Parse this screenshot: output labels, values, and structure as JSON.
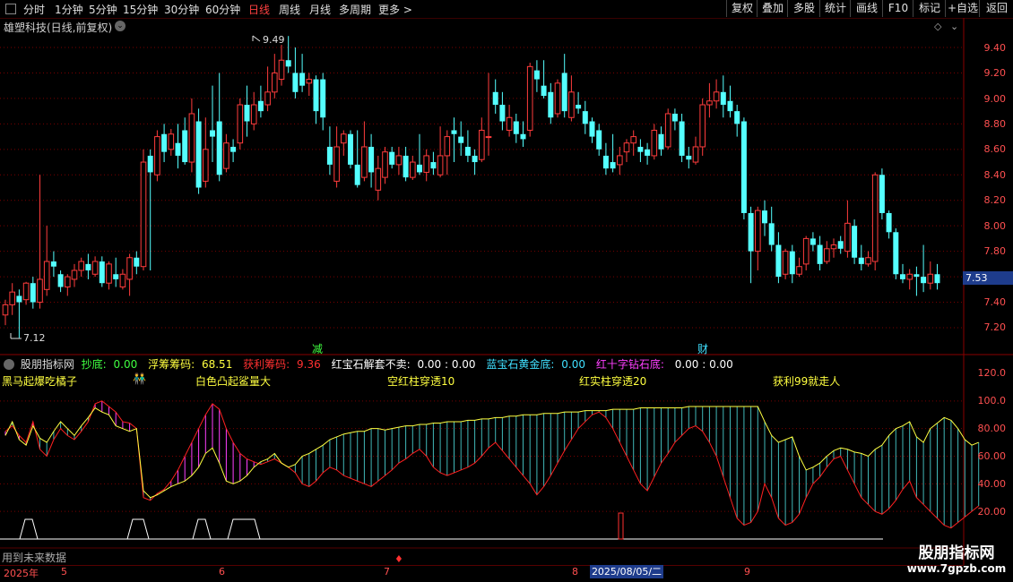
{
  "toolbar": {
    "periods": [
      "分时",
      "1分钟",
      "5分钟",
      "15分钟",
      "30分钟",
      "60分钟",
      "日线",
      "周线",
      "月线",
      "多周期",
      "更多 >"
    ],
    "buttons": [
      "复权",
      "叠加",
      "多股",
      "统计",
      "画线",
      "F10",
      "+自选",
      "返回"
    ]
  },
  "chart_title": "雄塑科技(日线,前复权)",
  "price_axis": [
    "9.40",
    "9.20",
    "9.00",
    "8.80",
    "8.60",
    "8.40",
    "8.20",
    "8.00",
    "7.80",
    "7.53",
    "7.40",
    "7.20"
  ],
  "current_price": "7.53",
  "high_label": "9.49",
  "low_label": "7.12",
  "markers": {
    "jian": "减",
    "cai": "财"
  },
  "indicator": {
    "name": "股朋指标网",
    "items": [
      {
        "label": "抄底:",
        "value": "0.00",
        "color": "#40ff40"
      },
      {
        "label": "浮筹筹码:",
        "value": "68.51",
        "color": "#ffff40"
      },
      {
        "label": "获利筹码:",
        "value": "9.36",
        "color": "#ff3030"
      },
      {
        "label": "红宝石解套不卖:",
        "value": "0.00 : 0.00",
        "color": "#ffffff"
      },
      {
        "label": "蓝宝石黄金底:",
        "value": "0.00",
        "color": "#40e0ff"
      },
      {
        "label": "红十字钻石底:",
        "value": "0.00 : 0.00",
        "color": "#ff40ff"
      }
    ],
    "labels": [
      "黑马起爆吃橘子",
      "白色凸起鲨量大",
      "空红柱穿透10",
      "红实柱穿透20",
      "获利99就走人"
    ],
    "axis": [
      "120.0",
      "100.0",
      "80.00",
      "60.00",
      "40.00",
      "20.00"
    ]
  },
  "bottom_note": "用到未来数据",
  "dates": {
    "year": "2025年",
    "m5": "5",
    "m6": "6",
    "m7": "7",
    "m8": "8",
    "m9": "9",
    "selected": "2025/08/05/二"
  },
  "watermark": {
    "line1": "股朋指标网",
    "line2": "www.7gpzb.com"
  },
  "colors": {
    "up": "#ff3c3c",
    "down": "#54ffff",
    "yellow": "#ffff40",
    "magenta": "#ff40ff",
    "grid": "#7a0000"
  },
  "chart_data": {
    "type": "candlestick",
    "candles": [
      [
        7.3,
        7.38,
        7.42,
        7.22
      ],
      [
        7.38,
        7.48,
        7.55,
        7.3
      ],
      [
        7.45,
        7.4,
        7.5,
        7.12
      ],
      [
        7.42,
        7.55,
        7.56,
        7.38
      ],
      [
        7.55,
        7.4,
        7.6,
        7.35
      ],
      [
        7.4,
        7.58,
        8.4,
        7.35
      ],
      [
        7.5,
        7.72,
        8.0,
        7.45
      ],
      [
        7.72,
        7.68,
        7.8,
        7.6
      ],
      [
        7.62,
        7.52,
        7.65,
        7.48
      ],
      [
        7.52,
        7.6,
        7.62,
        7.45
      ],
      [
        7.58,
        7.65,
        7.7,
        7.52
      ],
      [
        7.65,
        7.72,
        7.75,
        7.6
      ],
      [
        7.7,
        7.65,
        7.78,
        7.58
      ],
      [
        7.62,
        7.72,
        7.76,
        7.6
      ],
      [
        7.72,
        7.55,
        7.76,
        7.52
      ],
      [
        7.55,
        7.7,
        7.72,
        7.5
      ],
      [
        7.62,
        7.58,
        7.75,
        7.52
      ],
      [
        7.52,
        7.62,
        7.66,
        7.5
      ],
      [
        7.58,
        7.75,
        7.78,
        7.45
      ],
      [
        7.75,
        7.68,
        7.8,
        7.62
      ],
      [
        7.68,
        8.5,
        8.6,
        7.65
      ],
      [
        8.55,
        8.42,
        8.6,
        7.65
      ],
      [
        8.4,
        8.7,
        8.75,
        8.35
      ],
      [
        8.72,
        8.58,
        8.8,
        8.5
      ],
      [
        8.6,
        8.72,
        8.76,
        8.55
      ],
      [
        8.65,
        8.55,
        8.8,
        8.45
      ],
      [
        8.75,
        8.5,
        8.85,
        8.48
      ],
      [
        8.5,
        8.88,
        9.0,
        8.42
      ],
      [
        8.82,
        8.3,
        8.92,
        8.25
      ],
      [
        8.35,
        8.6,
        8.85,
        8.3
      ],
      [
        8.75,
        8.7,
        9.1,
        8.5
      ],
      [
        8.82,
        8.4,
        9.2,
        8.35
      ],
      [
        8.45,
        8.65,
        8.72,
        8.42
      ],
      [
        8.62,
        8.58,
        8.68,
        8.5
      ],
      [
        8.65,
        8.95,
        9.0,
        8.6
      ],
      [
        8.95,
        8.82,
        9.1,
        8.7
      ],
      [
        8.8,
        8.95,
        9.05,
        8.75
      ],
      [
        8.98,
        8.9,
        9.1,
        8.85
      ],
      [
        8.95,
        9.05,
        9.25,
        8.9
      ],
      [
        9.05,
        9.2,
        9.35,
        9.0
      ],
      [
        9.15,
        9.3,
        9.42,
        9.1
      ],
      [
        9.3,
        9.25,
        9.49,
        9.2
      ],
      [
        9.2,
        9.05,
        9.4,
        9.0
      ],
      [
        9.2,
        9.1,
        9.35,
        9.05
      ],
      [
        9.12,
        9.15,
        9.2,
        9.02
      ],
      [
        9.15,
        8.9,
        9.18,
        8.8
      ],
      [
        9.15,
        8.85,
        9.2,
        8.75
      ],
      [
        8.62,
        8.48,
        8.78,
        8.4
      ],
      [
        8.35,
        8.62,
        8.78,
        8.3
      ],
      [
        8.65,
        8.72,
        8.75,
        8.55
      ],
      [
        8.72,
        8.48,
        8.75,
        8.45
      ],
      [
        8.48,
        8.32,
        8.75,
        8.3
      ],
      [
        8.38,
        8.62,
        8.82,
        8.35
      ],
      [
        8.62,
        8.42,
        8.72,
        8.3
      ],
      [
        8.28,
        8.45,
        8.55,
        8.2
      ],
      [
        8.38,
        8.58,
        8.62,
        8.33
      ],
      [
        8.58,
        8.48,
        8.62,
        8.45
      ],
      [
        8.48,
        8.55,
        8.62,
        8.4
      ],
      [
        8.55,
        8.38,
        8.62,
        8.35
      ],
      [
        8.38,
        8.5,
        8.55,
        8.36
      ],
      [
        8.48,
        8.42,
        8.72,
        8.4
      ],
      [
        8.42,
        8.55,
        8.6,
        8.35
      ],
      [
        8.5,
        8.45,
        8.58,
        8.4
      ],
      [
        8.4,
        8.55,
        8.78,
        8.38
      ],
      [
        8.55,
        8.7,
        8.75,
        8.4
      ],
      [
        8.75,
        8.72,
        8.85,
        8.5
      ],
      [
        8.7,
        8.65,
        8.82,
        8.55
      ],
      [
        8.62,
        8.55,
        8.75,
        8.5
      ],
      [
        8.55,
        8.5,
        8.6,
        8.4
      ],
      [
        8.52,
        8.75,
        8.85,
        8.5
      ],
      [
        8.7,
        8.7,
        9.2,
        8.55
      ],
      [
        9.05,
        8.95,
        9.15,
        8.88
      ],
      [
        8.95,
        8.82,
        9.05,
        8.75
      ],
      [
        8.75,
        8.85,
        8.95,
        8.7
      ],
      [
        8.82,
        8.72,
        8.88,
        8.65
      ],
      [
        8.72,
        8.68,
        8.82,
        8.62
      ],
      [
        8.75,
        9.25,
        9.28,
        8.7
      ],
      [
        9.22,
        9.15,
        9.3,
        9.05
      ],
      [
        9.1,
        9.02,
        9.3,
        9.0
      ],
      [
        9.05,
        8.85,
        9.12,
        8.8
      ],
      [
        8.88,
        9.12,
        9.15,
        8.85
      ],
      [
        9.2,
        8.9,
        9.35,
        8.85
      ],
      [
        8.85,
        9.05,
        9.18,
        8.82
      ],
      [
        8.95,
        8.92,
        9.05,
        8.88
      ],
      [
        8.9,
        8.8,
        8.98,
        8.72
      ],
      [
        8.82,
        8.7,
        8.85,
        8.65
      ],
      [
        8.75,
        8.6,
        8.8,
        8.55
      ],
      [
        8.55,
        8.45,
        8.65,
        8.4
      ],
      [
        8.5,
        8.45,
        8.72,
        8.42
      ],
      [
        8.48,
        8.55,
        8.62,
        8.4
      ],
      [
        8.58,
        8.65,
        8.68,
        8.5
      ],
      [
        8.65,
        8.7,
        8.75,
        8.55
      ],
      [
        8.62,
        8.58,
        8.68,
        8.5
      ],
      [
        8.6,
        8.55,
        8.65,
        8.48
      ],
      [
        8.55,
        8.75,
        8.8,
        8.52
      ],
      [
        8.72,
        8.6,
        8.78,
        8.55
      ],
      [
        8.62,
        8.88,
        8.92,
        8.6
      ],
      [
        8.88,
        8.82,
        8.92,
        8.75
      ],
      [
        8.82,
        8.55,
        8.88,
        8.5
      ],
      [
        8.55,
        8.52,
        8.62,
        8.45
      ],
      [
        8.5,
        8.62,
        8.7,
        8.48
      ],
      [
        8.62,
        8.95,
        9.0,
        8.55
      ],
      [
        8.95,
        8.98,
        9.12,
        8.85
      ],
      [
        8.98,
        9.05,
        9.15,
        8.92
      ],
      [
        9.05,
        8.95,
        9.18,
        8.85
      ],
      [
        8.98,
        8.9,
        9.1,
        8.85
      ],
      [
        8.9,
        8.8,
        8.95,
        8.7
      ],
      [
        8.82,
        8.1,
        8.85,
        8.05
      ],
      [
        8.1,
        7.8,
        8.15,
        7.55
      ],
      [
        7.8,
        8.12,
        8.15,
        7.65
      ],
      [
        8.12,
        8.02,
        8.2,
        7.92
      ],
      [
        8.02,
        7.85,
        8.15,
        7.8
      ],
      [
        7.85,
        7.6,
        7.95,
        7.55
      ],
      [
        7.62,
        7.8,
        7.82,
        7.58
      ],
      [
        7.8,
        7.62,
        7.85,
        7.55
      ],
      [
        7.62,
        7.68,
        7.75,
        7.6
      ],
      [
        7.7,
        7.9,
        7.92,
        7.65
      ],
      [
        7.9,
        7.85,
        7.95,
        7.8
      ],
      [
        7.85,
        7.7,
        7.92,
        7.65
      ],
      [
        7.72,
        7.82,
        7.88,
        7.7
      ],
      [
        7.82,
        7.85,
        7.9,
        7.75
      ],
      [
        7.88,
        7.82,
        7.92,
        7.78
      ],
      [
        7.8,
        8.02,
        8.2,
        7.75
      ],
      [
        8.0,
        7.75,
        8.05,
        7.7
      ],
      [
        7.75,
        7.7,
        7.85,
        7.65
      ],
      [
        7.7,
        7.75,
        7.8,
        7.68
      ],
      [
        7.72,
        8.4,
        8.42,
        7.65
      ],
      [
        8.4,
        8.1,
        8.45,
        8.05
      ],
      [
        8.1,
        7.95,
        8.12,
        7.9
      ],
      [
        7.95,
        7.62,
        7.98,
        7.58
      ],
      [
        7.62,
        7.58,
        7.7,
        7.55
      ],
      [
        7.58,
        7.62,
        7.66,
        7.5
      ],
      [
        7.62,
        7.6,
        7.68,
        7.45
      ],
      [
        7.6,
        7.55,
        7.85,
        7.48
      ],
      [
        7.55,
        7.62,
        7.72,
        7.5
      ],
      [
        7.62,
        7.55,
        7.7,
        7.5
      ]
    ]
  }
}
